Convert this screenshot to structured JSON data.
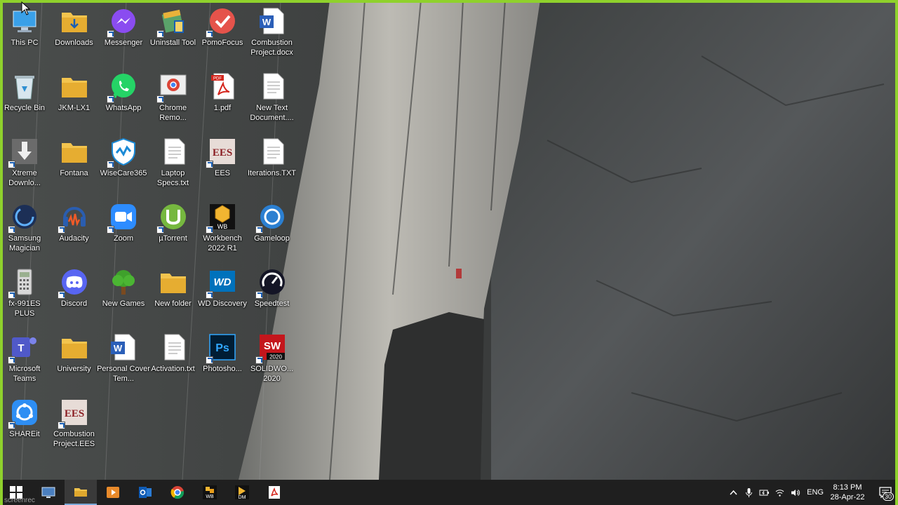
{
  "desktop": {
    "icons": [
      {
        "label": "This PC",
        "icon": "this-pc-icon"
      },
      {
        "label": "Downloads",
        "icon": "downloads-folder-icon"
      },
      {
        "label": "Messenger",
        "icon": "messenger-icon"
      },
      {
        "label": "Uninstall Tool",
        "icon": "uninstall-tool-icon"
      },
      {
        "label": "PomoFocus",
        "icon": "pomofocus-icon"
      },
      {
        "label": "Combustion Project.docx",
        "icon": "word-document-icon"
      },
      {
        "label": "Recycle Bin",
        "icon": "recycle-bin-icon"
      },
      {
        "label": "JKM-LX1",
        "icon": "folder-icon"
      },
      {
        "label": "WhatsApp",
        "icon": "whatsapp-icon"
      },
      {
        "label": "Chrome Remo...",
        "icon": "chrome-remote-icon"
      },
      {
        "label": "1.pdf",
        "icon": "pdf-file-icon"
      },
      {
        "label": "New Text Document....",
        "icon": "text-file-icon"
      },
      {
        "label": "Xtreme Downlo...",
        "icon": "xtreme-download-icon"
      },
      {
        "label": "Fontana",
        "icon": "folder-icon"
      },
      {
        "label": "WiseCare365",
        "icon": "wisecare-icon"
      },
      {
        "label": "Laptop Specs.txt",
        "icon": "text-file-icon"
      },
      {
        "label": "EES",
        "icon": "ees-icon"
      },
      {
        "label": "Iterations.TXT",
        "icon": "text-file-icon"
      },
      {
        "label": "Samsung Magician",
        "icon": "samsung-magician-icon"
      },
      {
        "label": "Audacity",
        "icon": "audacity-icon"
      },
      {
        "label": "Zoom",
        "icon": "zoom-icon"
      },
      {
        "label": "µTorrent",
        "icon": "utorrent-icon"
      },
      {
        "label": "Workbench 2022 R1",
        "icon": "workbench-icon"
      },
      {
        "label": "Gameloop",
        "icon": "gameloop-icon"
      },
      {
        "label": "fx-991ES PLUS",
        "icon": "calculator-icon"
      },
      {
        "label": "Discord",
        "icon": "discord-icon"
      },
      {
        "label": "New Games",
        "icon": "tree-icon"
      },
      {
        "label": "New folder",
        "icon": "folder-icon"
      },
      {
        "label": "WD Discovery",
        "icon": "wd-discovery-icon"
      },
      {
        "label": "Speedtest",
        "icon": "speedtest-icon"
      },
      {
        "label": "Microsoft Teams",
        "icon": "teams-icon"
      },
      {
        "label": "University",
        "icon": "folder-icon"
      },
      {
        "label": "Personal Cover Tem...",
        "icon": "word-document-icon"
      },
      {
        "label": "Activation.txt",
        "icon": "text-file-icon"
      },
      {
        "label": "Photosho...",
        "icon": "photoshop-icon"
      },
      {
        "label": "SOLIDWO... 2020",
        "icon": "solidworks-icon"
      },
      {
        "label": "SHAREit",
        "icon": "shareit-icon"
      },
      {
        "label": "Combustion Project.EES",
        "icon": "ees-icon"
      }
    ]
  },
  "taskbar": {
    "apps": [
      {
        "name": "start-button",
        "icon": "windows-logo-icon"
      },
      {
        "name": "taskbar-app-remote",
        "icon": "remote-desktop-icon"
      },
      {
        "name": "taskbar-app-file-explorer",
        "icon": "file-explorer-icon",
        "active": true
      },
      {
        "name": "taskbar-app-media-player",
        "icon": "media-player-icon"
      },
      {
        "name": "taskbar-app-outlook",
        "icon": "outlook-icon"
      },
      {
        "name": "taskbar-app-chrome",
        "icon": "chrome-icon"
      },
      {
        "name": "taskbar-app-workbench",
        "icon": "workbench-icon",
        "badge": "WB"
      },
      {
        "name": "taskbar-app-download-manager",
        "icon": "download-manager-icon",
        "badge": "DM"
      },
      {
        "name": "taskbar-app-acrobat",
        "icon": "acrobat-icon"
      }
    ],
    "tray": {
      "language": "ENG",
      "time": "8:13 PM",
      "date": "28-Apr-22",
      "notification_count": "30"
    }
  },
  "watermark": "screenrec",
  "colors": {
    "frame_border": "#8fd12c",
    "taskbar_bg": "#1f1f1f",
    "icon_label": "#ffffff"
  }
}
